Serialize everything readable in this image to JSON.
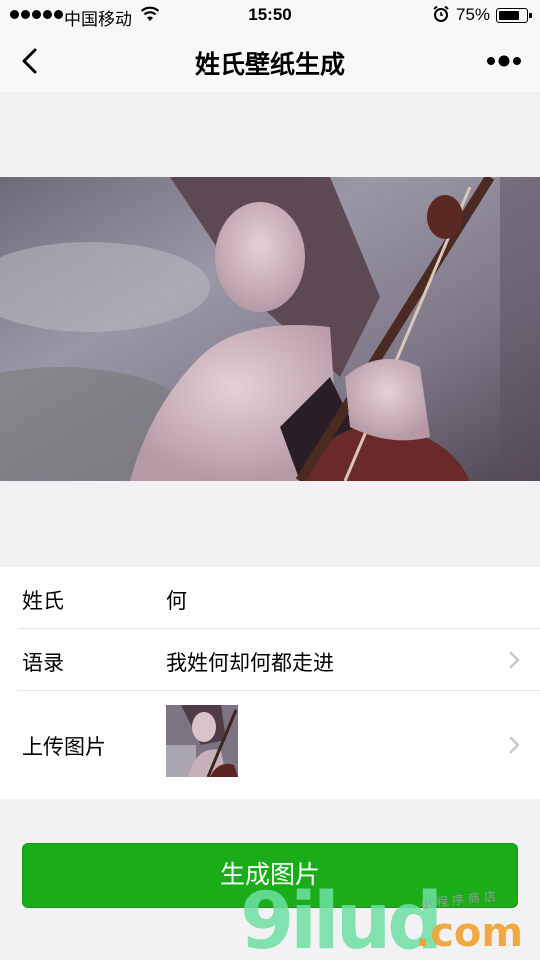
{
  "status_bar": {
    "carrier": "中国移动",
    "time": "15:50",
    "battery_percent_text": "75%",
    "battery_level": 0.75
  },
  "nav": {
    "title": "姓氏壁纸生成",
    "back_icon": "chevron-left-icon",
    "more_icon": "more-dots-icon"
  },
  "form": {
    "surname": {
      "label": "姓氏",
      "value": "何"
    },
    "quote": {
      "label": "语录",
      "value": "我姓何却何都走进"
    },
    "upload": {
      "label": "上传图片"
    }
  },
  "button": {
    "label": "生成图片",
    "color": "#1aad19"
  },
  "watermark": {
    "digits": "9ilud",
    "domain": ".com",
    "tag": "小程序商店"
  }
}
